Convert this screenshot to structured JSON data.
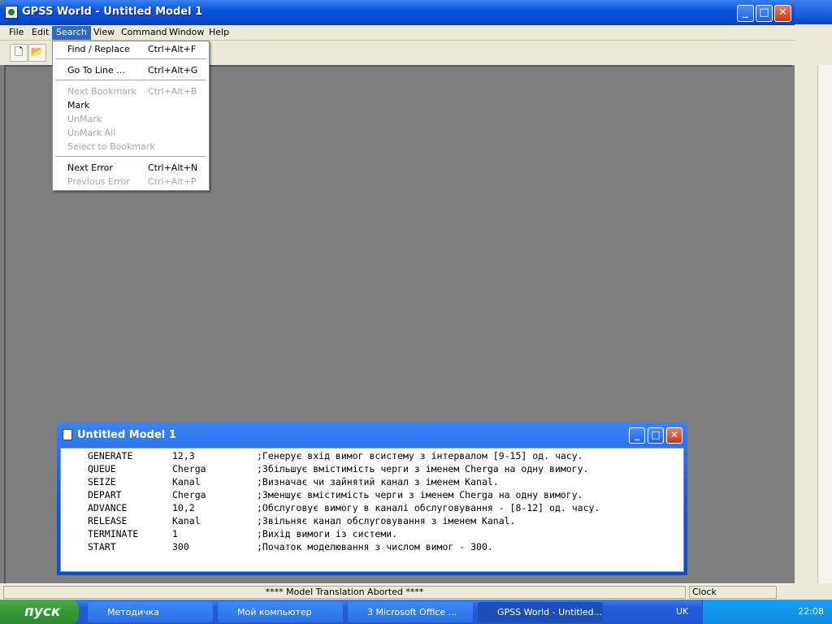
{
  "window": {
    "title": "GPSS World - Untitled Model 1",
    "min": "_",
    "max": "□",
    "close": "✕"
  },
  "menu": [
    "File",
    "Edit",
    "Search",
    "View",
    "Command",
    "Window",
    "Help"
  ],
  "search_menu": {
    "items": [
      {
        "label": "Find / Replace",
        "shortcut": "Ctrl+Alt+F"
      },
      {
        "label": "Go To Line ...",
        "shortcut": "Ctrl+Alt+G"
      },
      {
        "label": "Next Bookmark",
        "shortcut": "Ctrl+Alt+B"
      },
      {
        "label": "Mark",
        "shortcut": ""
      },
      {
        "label": "UnMark",
        "shortcut": ""
      },
      {
        "label": "UnMark All",
        "shortcut": ""
      },
      {
        "label": "Select to Bookmark",
        "shortcut": ""
      },
      {
        "label": "Next Error",
        "shortcut": "Ctrl+Alt+N"
      },
      {
        "label": "Previous Error",
        "shortcut": "Ctrl+Alt+P"
      }
    ]
  },
  "child_window": {
    "title": "Untitled Model 1"
  },
  "code": [
    {
      "op": "GENERATE",
      "arg": "12,3",
      "comment": ";Генерує вхід вимог всистему з інтервалом [9-15] од. часу."
    },
    {
      "op": "QUEUE",
      "arg": "Cherga",
      "comment": ";Збільшує вмістимість черги з іменем Cherga на одну вимогу."
    },
    {
      "op": "SEIZE",
      "arg": "Kanal",
      "comment": ";Визначає чи зайнятий канал з іменем Kanal."
    },
    {
      "op": "DEPART",
      "arg": "Cherga",
      "comment": ";Зменшує вмістимість черги з іменем Cherga на одну вимогу."
    },
    {
      "op": "ADVANCE",
      "arg": "10,2",
      "comment": ";Обслуговує вимогу в каналі обслуговування - [8-12] од. часу."
    },
    {
      "op": "RELEASE",
      "arg": "Kanal",
      "comment": ";Звільняє канал обслуговування з іменем Kanal."
    },
    {
      "op": "TERMINATE",
      "arg": "1",
      "comment": ";Вихід вимоги із системи."
    },
    {
      "op": "START",
      "arg": "300",
      "comment": ";Початок моделювання з числом вимог - 300."
    }
  ],
  "status": {
    "message": "**** Model Translation Aborted ****",
    "clock": "Clock"
  },
  "taskbar": {
    "start": "пуск",
    "tasks": [
      "Методичка",
      "Мой компьютер",
      "3 Microsoft Office ...",
      "GPSS World - Untitled..."
    ],
    "lang": "UK",
    "time": "22:08"
  }
}
